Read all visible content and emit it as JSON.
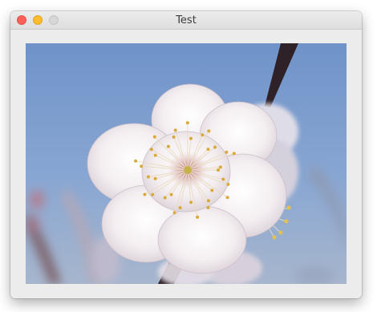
{
  "window": {
    "title": "Test",
    "traffic_lights": [
      "close",
      "minimize",
      "zoom"
    ]
  },
  "photo": {
    "subject": "flower-photo"
  },
  "colors": {
    "close": "#fe5f57",
    "minimize": "#febc2e",
    "zoom_inactive": "#d7d7d7",
    "sky": "#7d9ccb"
  }
}
